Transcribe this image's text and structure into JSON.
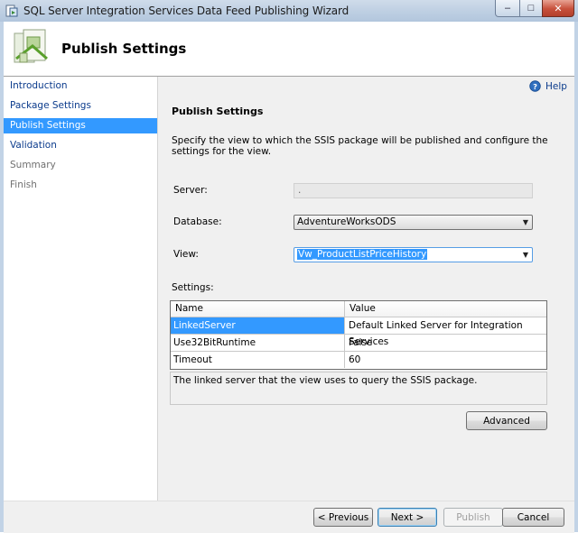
{
  "window": {
    "title": "SQL Server Integration Services Data Feed Publishing Wizard",
    "controls": {
      "minimize": "–",
      "maximize": "□",
      "close": "✕"
    }
  },
  "header": {
    "title": "Publish Settings"
  },
  "nav": {
    "items": [
      {
        "label": "Introduction",
        "state": "link"
      },
      {
        "label": "Package Settings",
        "state": "link"
      },
      {
        "label": "Publish Settings",
        "state": "selected"
      },
      {
        "label": "Validation",
        "state": "link"
      },
      {
        "label": "Summary",
        "state": "disabled"
      },
      {
        "label": "Finish",
        "state": "disabled"
      }
    ]
  },
  "help": {
    "label": "Help"
  },
  "main": {
    "section_title": "Publish Settings",
    "description": "Specify the view to which the SSIS package will be published and configure the settings for the view.",
    "server": {
      "label": "Server:",
      "value": "."
    },
    "database": {
      "label": "Database:",
      "value": "AdventureWorksODS"
    },
    "view": {
      "label": "View:",
      "value": "Vw_ProductListPriceHistory"
    },
    "settings_label": "Settings:",
    "grid": {
      "columns": [
        "Name",
        "Value"
      ],
      "rows": [
        {
          "name": "LinkedServer",
          "value": "Default Linked Server for Integration Services",
          "selected": true
        },
        {
          "name": "Use32BitRuntime",
          "value": "False",
          "selected": false
        },
        {
          "name": "Timeout",
          "value": "60",
          "selected": false
        }
      ]
    },
    "property_description": "The linked server that the view uses to query the SSIS package.",
    "advanced_label": "Advanced"
  },
  "footer": {
    "previous": "< Previous",
    "next": "Next >",
    "publish": "Publish",
    "cancel": "Cancel"
  },
  "colors": {
    "selection": "#3399ff",
    "link": "#0b3b8c"
  }
}
